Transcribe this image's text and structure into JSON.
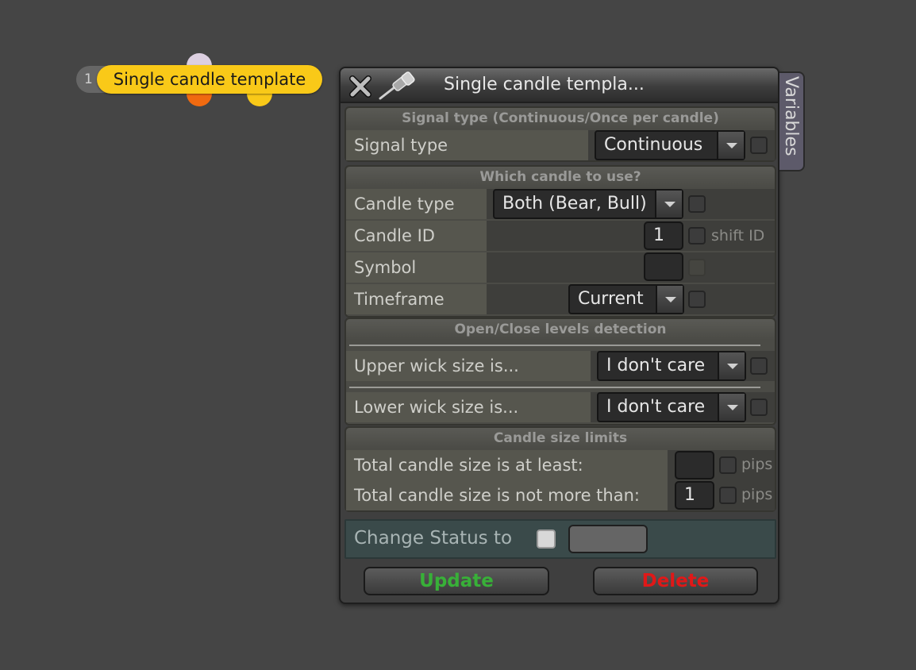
{
  "node": {
    "number": "1",
    "label": "Single candle template",
    "colors": {
      "pill": "#f9c918",
      "port_top": "#dccfe0",
      "port_left": "#f06a10",
      "port_right": "#f9c918"
    }
  },
  "dialog": {
    "title": "Single candle templa...",
    "side_tab": "Variables",
    "icons": {
      "close": "close-icon",
      "pin": "pin-icon"
    }
  },
  "signal_section": {
    "header": "Signal type (Continuous/Once per candle)",
    "signal_type": {
      "label": "Signal type",
      "value": "Continuous",
      "checked": false
    }
  },
  "candle_section": {
    "header": "Which candle to use?",
    "candle_type": {
      "label": "Candle type",
      "value": "Both (Bear, Bull)",
      "checked": false
    },
    "candle_id": {
      "label": "Candle ID",
      "value": "1",
      "checked": false,
      "suffix": "shift ID"
    },
    "symbol": {
      "label": "Symbol",
      "value": ""
    },
    "timeframe": {
      "label": "Timeframe",
      "value": "Current",
      "checked": false
    }
  },
  "levels_section": {
    "header": "Open/Close levels detection",
    "upper_wick": {
      "label": "Upper wick size is...",
      "value": "I don't care",
      "checked": false
    },
    "lower_wick": {
      "label": "Lower wick size is...",
      "value": "I don't care",
      "checked": false
    }
  },
  "size_section": {
    "header": "Candle size limits",
    "min_size": {
      "label": "Total candle size is at least:",
      "value": "",
      "unit": "pips",
      "checked": false
    },
    "max_size": {
      "label": "Total candle size is not more than:",
      "value": "1",
      "unit": "pips",
      "checked": false
    }
  },
  "status": {
    "label": "Change Status to",
    "checked": false,
    "value": ""
  },
  "buttons": {
    "update": "Update",
    "delete": "Delete"
  },
  "colors": {
    "update": "#38b038",
    "delete": "#e01818"
  }
}
